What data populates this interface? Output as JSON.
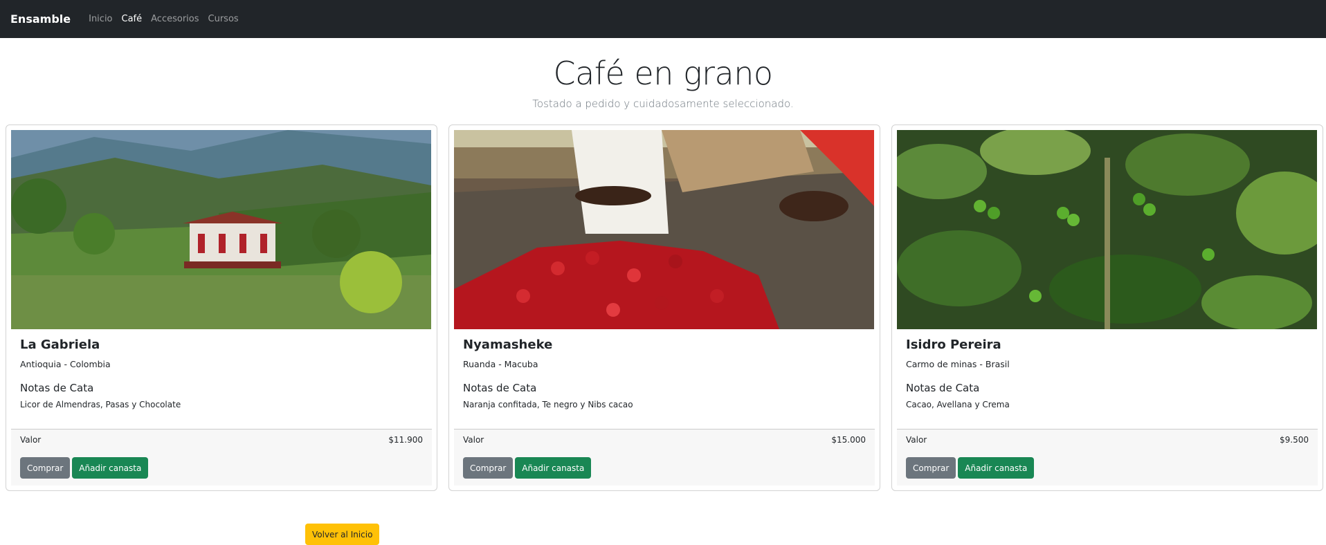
{
  "nav": {
    "brand": "Ensamble",
    "links": [
      {
        "label": "Inicio",
        "active": false
      },
      {
        "label": "Café",
        "active": true
      },
      {
        "label": "Accesorios",
        "active": false
      },
      {
        "label": "Cursos",
        "active": false
      }
    ]
  },
  "hero": {
    "title": "Café en grano",
    "subtitle": "Tostado a pedido y cuidadosamente seleccionado."
  },
  "cards": [
    {
      "name": "La Gabriela",
      "origin": "Antioquia - Colombia",
      "notes_title": "Notas de Cata",
      "notes": "Licor de Almendras, Pasas y Chocolate",
      "price_label": "Valor",
      "price": "$11.900",
      "buy_label": "Comprar",
      "cart_label": "Añadir canasta",
      "image": "mountain-farm-house"
    },
    {
      "name": "Nyamasheke",
      "origin": "Ruanda - Macuba",
      "notes_title": "Notas de Cata",
      "notes": "Naranja confitada, Te negro y Nibs cacao",
      "price_label": "Valor",
      "price": "$15.000",
      "buy_label": "Comprar",
      "cart_label": "Añadir canasta",
      "image": "red-coffee-cherries-harvest"
    },
    {
      "name": "Isidro Pereira",
      "origin": "Carmo de minas - Brasil",
      "notes_title": "Notas de Cata",
      "notes": "Cacao, Avellana y Crema",
      "price_label": "Valor",
      "price": "$9.500",
      "buy_label": "Comprar",
      "cart_label": "Añadir canasta",
      "image": "green-coffee-plant"
    }
  ],
  "back_button": "Volver al Inicio",
  "colors": {
    "navbar": "#212529",
    "button_gray": "#6c757d",
    "button_green": "#198754",
    "button_yellow": "#ffc107"
  }
}
